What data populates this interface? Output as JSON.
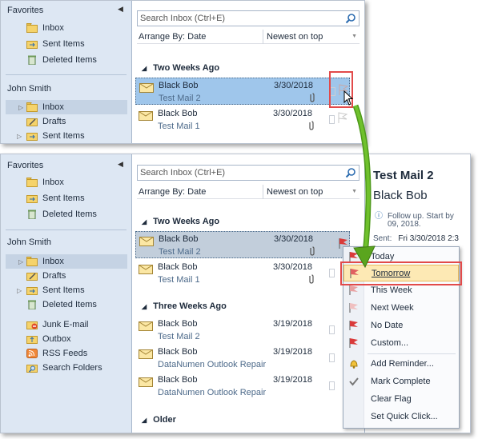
{
  "top": {
    "nav": {
      "favorites": "Favorites",
      "fav_items": [
        "Inbox",
        "Sent Items",
        "Deleted Items"
      ],
      "account": "John Smith",
      "account_items": [
        "Inbox",
        "Drafts",
        "Sent Items"
      ]
    },
    "search_placeholder": "Search Inbox (Ctrl+E)",
    "arrange_by": "Arrange By: Date",
    "sort_order": "Newest on top",
    "group": "Two Weeks Ago",
    "mails": [
      {
        "sender": "Black Bob",
        "date": "3/30/2018",
        "subject": "Test Mail 2"
      },
      {
        "sender": "Black Bob",
        "date": "3/30/2018",
        "subject": "Test Mail 1"
      }
    ]
  },
  "bottom": {
    "nav": {
      "favorites": "Favorites",
      "fav_items": [
        "Inbox",
        "Sent Items",
        "Deleted Items"
      ],
      "account": "John Smith",
      "account_items": [
        "Inbox",
        "Drafts",
        "Sent Items",
        "Deleted Items",
        "Junk E-mail",
        "Outbox",
        "RSS Feeds",
        "Search Folders"
      ]
    },
    "search_placeholder": "Search Inbox (Ctrl+E)",
    "arrange_by": "Arrange By: Date",
    "sort_order": "Newest on top",
    "groups": [
      "Two Weeks Ago",
      "Three Weeks Ago",
      "Older"
    ],
    "mails_two_weeks": [
      {
        "sender": "Black Bob",
        "date": "3/30/2018",
        "subject": "Test Mail 2"
      },
      {
        "sender": "Black Bob",
        "date": "3/30/2018",
        "subject": "Test Mail 1"
      }
    ],
    "mails_three_weeks": [
      {
        "sender": "Black Bob",
        "date": "3/19/2018",
        "subject": "Test Mail 2"
      },
      {
        "sender": "Black Bob",
        "date": "3/19/2018",
        "subject": "DataNumen Outlook Repair"
      },
      {
        "sender": "Black Bob",
        "date": "3/19/2018",
        "subject": "DataNumen Outlook Repair"
      }
    ],
    "reading": {
      "title": "Test Mail 2",
      "from": "Black Bob",
      "info_line1": "Follow up.  Start by",
      "info_line2": "09, 2018.",
      "sent_label": "Sent:",
      "sent_value": "Fri 3/30/2018 2:3"
    },
    "flag_menu": [
      "Today",
      "Tomorrow",
      "This Week",
      "Next Week",
      "No Date",
      "Custom...",
      "Add Reminder...",
      "Mark Complete",
      "Clear Flag",
      "Set Quick Click..."
    ]
  },
  "colors": {
    "highlight_box": "#e24a4a",
    "arrow": "#5aa51e",
    "selected_row": "#9fc6eb"
  }
}
